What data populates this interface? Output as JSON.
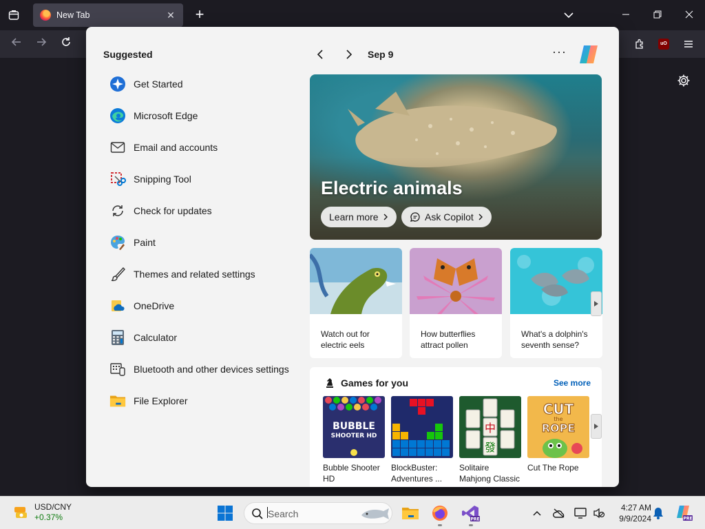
{
  "browser": {
    "tab_title": "New Tab",
    "new_tab_symbol": "+",
    "close_symbol": "✕"
  },
  "panel": {
    "suggested_title": "Suggested",
    "suggested_items": [
      {
        "label": "Get Started",
        "icon": "get-started-icon"
      },
      {
        "label": "Microsoft Edge",
        "icon": "edge-icon"
      },
      {
        "label": "Email and accounts",
        "icon": "mail-icon"
      },
      {
        "label": "Snipping Tool",
        "icon": "snipping-tool-icon"
      },
      {
        "label": "Check for updates",
        "icon": "refresh-icon"
      },
      {
        "label": "Paint",
        "icon": "paint-icon"
      },
      {
        "label": "Themes and related settings",
        "icon": "brush-icon"
      },
      {
        "label": "OneDrive",
        "icon": "onedrive-icon"
      },
      {
        "label": "Calculator",
        "icon": "calculator-icon"
      },
      {
        "label": "Bluetooth and other devices settings",
        "icon": "devices-icon"
      },
      {
        "label": "File Explorer",
        "icon": "folder-icon"
      }
    ],
    "date": "Sep 9",
    "more_symbol": "···",
    "hero": {
      "title": "Electric animals",
      "learn_more": "Learn more",
      "ask_copilot": "Ask Copilot"
    },
    "cards": [
      {
        "caption": "Watch out for electric eels"
      },
      {
        "caption": "How butterflies attract pollen"
      },
      {
        "caption": "What's a dolphin's seventh sense?"
      }
    ],
    "games": {
      "title": "Games for you",
      "see_more": "See more",
      "items": [
        {
          "name": "Bubble Shooter HD",
          "art_text": "BUBBLE SHOOTER HD"
        },
        {
          "name": "BlockBuster: Adventures ...",
          "art_text": ""
        },
        {
          "name": "Solitaire Mahjong Classic",
          "art_text": "中 發"
        },
        {
          "name": "Cut The Rope",
          "art_text": "CUT the ROPE"
        }
      ]
    }
  },
  "taskbar": {
    "ticker_name": "USD/CNY",
    "ticker_change": "+0.37%",
    "search_placeholder": "Search",
    "time": "4:27 AM",
    "date": "9/9/2024"
  },
  "colors": {
    "accent": "#005fb8",
    "positive": "#0f7b0f",
    "panel_bg": "#f3f3f3",
    "browser_dark": "#1c1b22"
  }
}
